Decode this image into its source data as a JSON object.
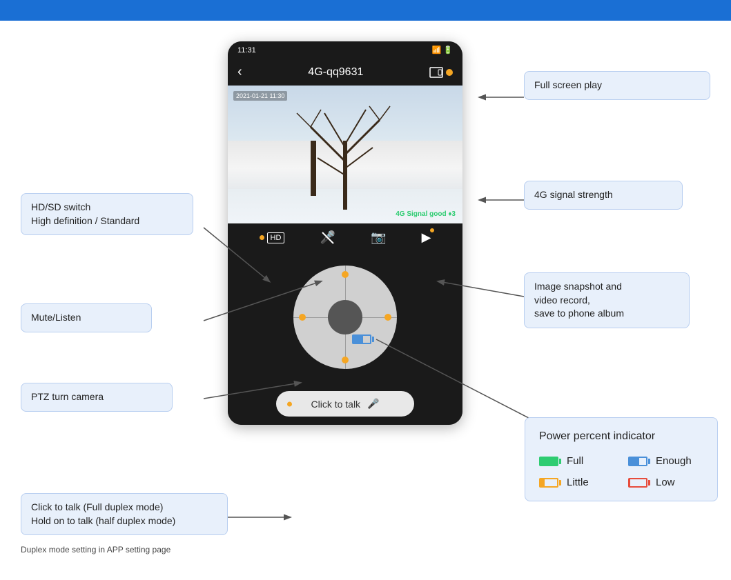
{
  "header": {
    "bg_color": "#1a6fd4"
  },
  "phone": {
    "status_time": "11:31",
    "title": "4G-qq9631",
    "signal_text": "4G Signal good ♦3"
  },
  "annotations": {
    "full_screen": "Full screen play",
    "signal_strength": "4G signal strength",
    "hd_sd": "HD/SD switch\nHigh definition / Standard",
    "mute": "Mute/Listen",
    "ptz": "PTZ turn camera",
    "snapshot": "Image snapshot and\nvideo record,\nsave to phone album",
    "click_to_talk_label": "Click to talk",
    "talk_annotation": "Click to talk   (Full duplex mode)\nHold on to talk (half duplex mode)",
    "duplex_note": "Duplex mode setting in APP setting page",
    "power_title": "Power percent indicator",
    "power_full_label": "Full",
    "power_enough_label": "Enough",
    "power_little_label": "Little",
    "power_low_label": "Low"
  },
  "controls": {
    "hd_label": "HD"
  }
}
